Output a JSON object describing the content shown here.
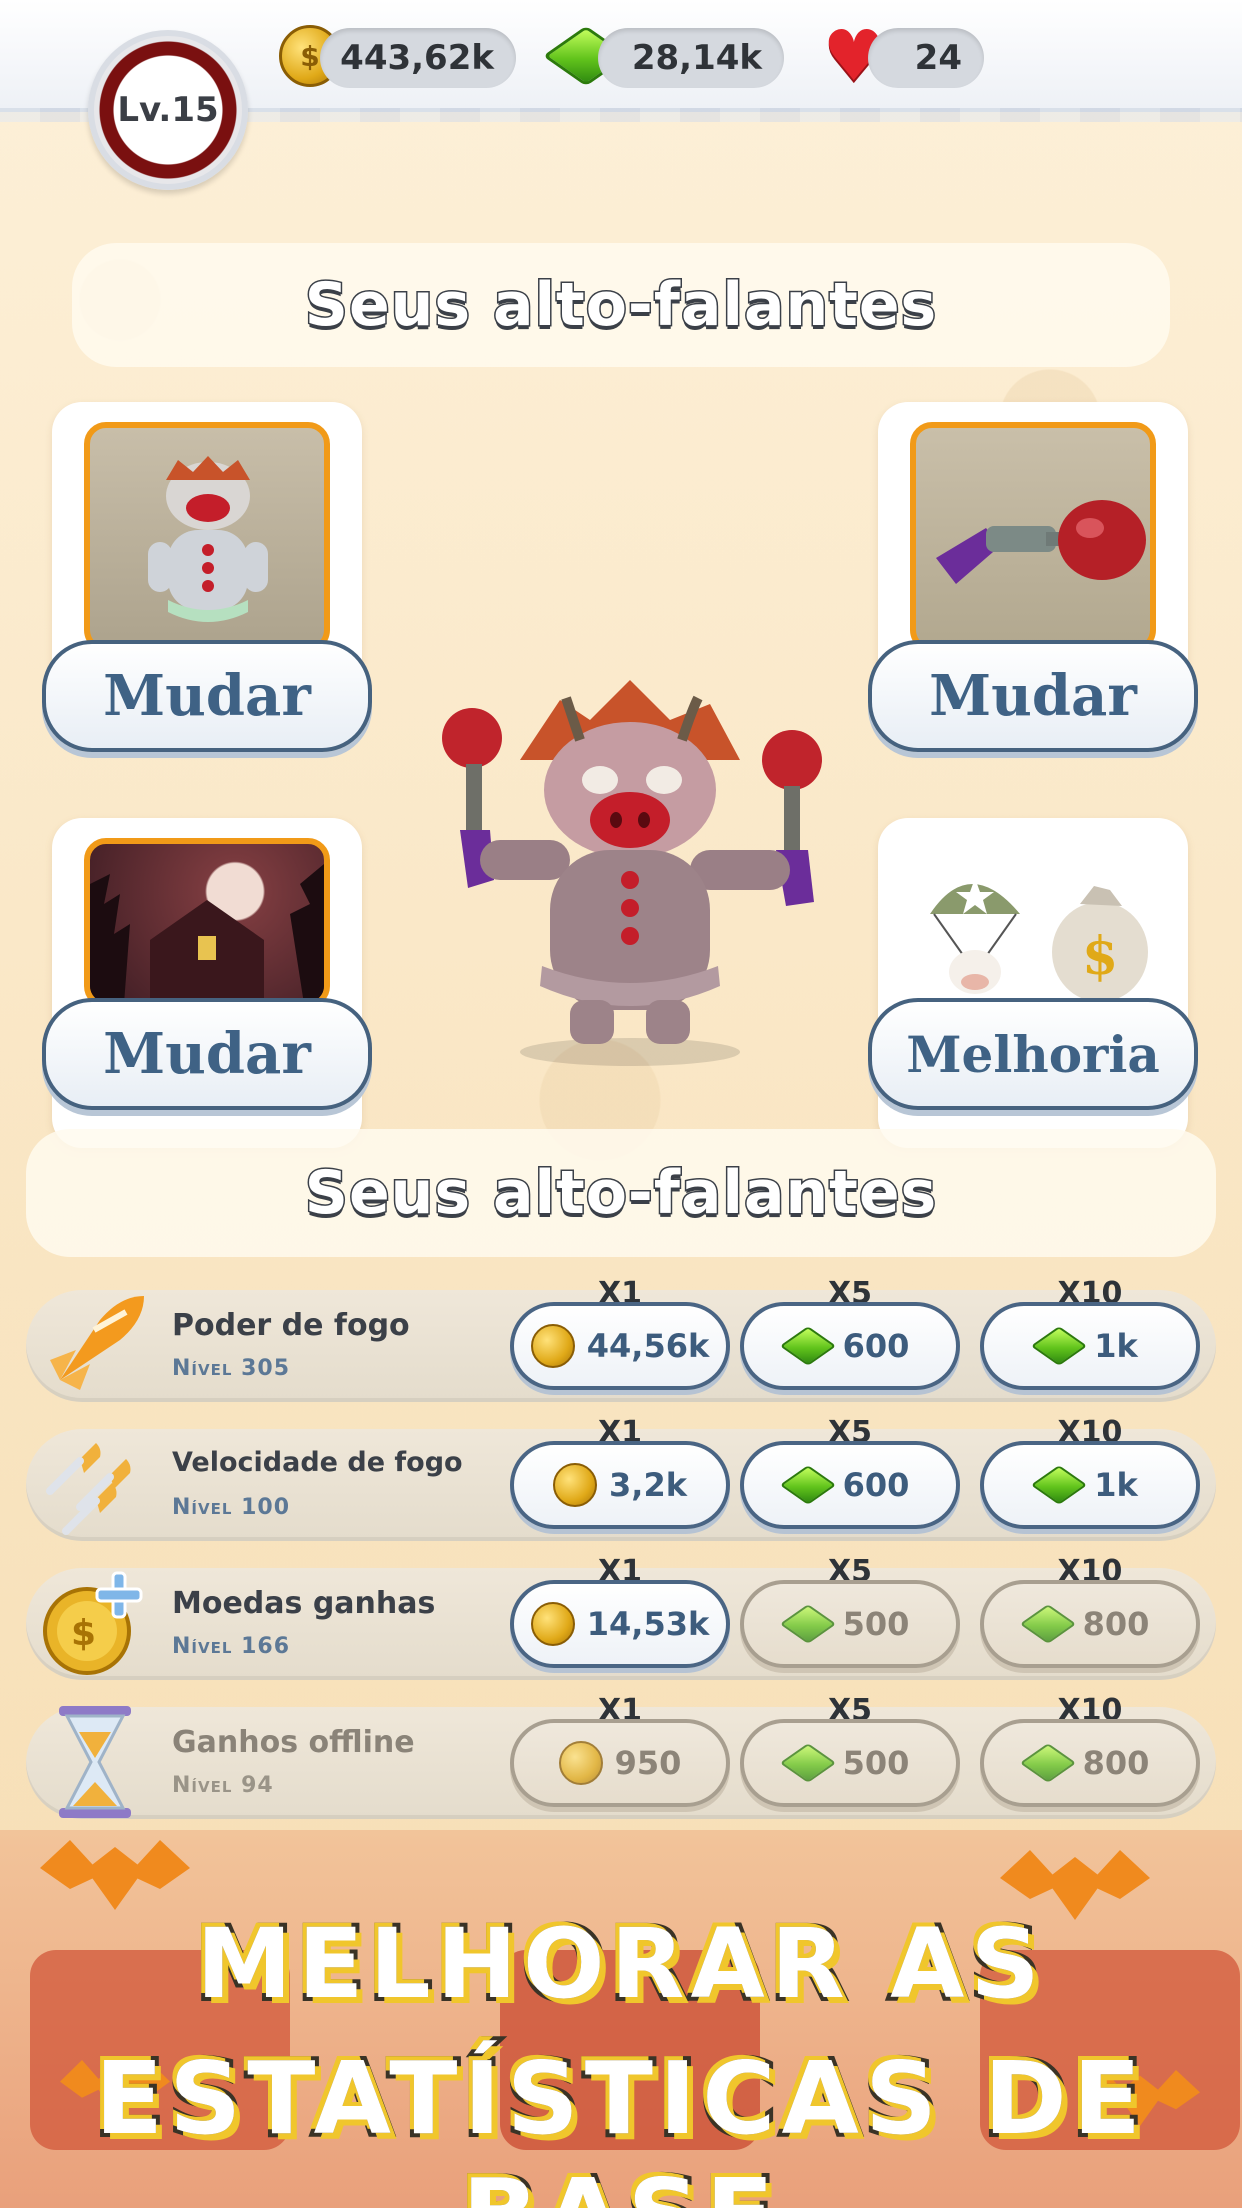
{
  "header": {
    "level_label": "Lv.15",
    "coins": "443,62k",
    "gems": "28,14k",
    "hearts": "24"
  },
  "section1": {
    "title": "Seus alto-falantes"
  },
  "slots": {
    "top_left": {
      "button": "Mudar",
      "icon": "clown-cow-icon"
    },
    "top_right": {
      "button": "Mudar",
      "icon": "plunger-gun-icon"
    },
    "bottom_left": {
      "button": "Mudar",
      "icon": "haunted-house-icon"
    },
    "bottom_right": {
      "button": "Melhoria",
      "icon": "parachute-supply-icon"
    }
  },
  "section2": {
    "title": "Seus alto-falantes"
  },
  "upgrades": [
    {
      "name": "Poder de fogo",
      "level_word": "Nível",
      "level": "305",
      "icon": "rocket-icon",
      "options": [
        {
          "mult": "X1",
          "currency": "coin",
          "cost": "44,56k"
        },
        {
          "mult": "X5",
          "currency": "gem",
          "cost": "600"
        },
        {
          "mult": "X10",
          "currency": "gem",
          "cost": "1k"
        }
      ]
    },
    {
      "name": "Velocidade de fogo",
      "level_word": "Nível",
      "level": "100",
      "icon": "bullets-icon",
      "options": [
        {
          "mult": "X1",
          "currency": "coin",
          "cost": "3,2k"
        },
        {
          "mult": "X5",
          "currency": "gem",
          "cost": "600"
        },
        {
          "mult": "X10",
          "currency": "gem",
          "cost": "1k"
        }
      ]
    },
    {
      "name": "Moedas ganhas",
      "level_word": "Nível",
      "level": "166",
      "icon": "coin-plus-icon",
      "options": [
        {
          "mult": "X1",
          "currency": "coin",
          "cost": "14,53k"
        },
        {
          "mult": "X5",
          "currency": "gem",
          "cost": "500"
        },
        {
          "mult": "X10",
          "currency": "gem",
          "cost": "800"
        }
      ]
    },
    {
      "name": "Ganhos offline",
      "level_word": "Nível",
      "level": "94",
      "icon": "hourglass-icon",
      "options": [
        {
          "mult": "X1",
          "currency": "coin",
          "cost": "950"
        },
        {
          "mult": "X5",
          "currency": "gem",
          "cost": "500"
        },
        {
          "mult": "X10",
          "currency": "gem",
          "cost": "800"
        }
      ]
    }
  ],
  "banner": {
    "line1": "MELHORAR AS",
    "line2": "ESTATÍSTICAS DE BASE"
  },
  "colors": {
    "accent_blue": "#3f6285",
    "frame_orange": "#f19a18",
    "background": "#fbe9c8"
  }
}
